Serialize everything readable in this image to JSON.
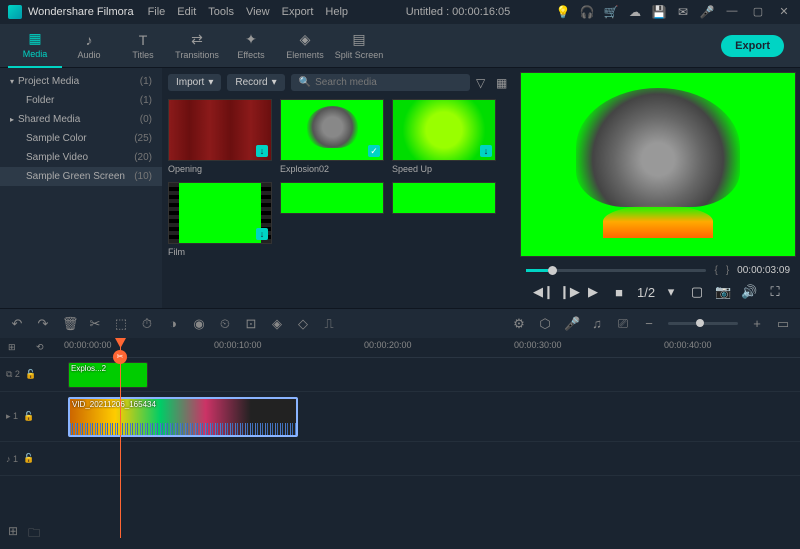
{
  "app": {
    "name": "Wondershare Filmora"
  },
  "menu": [
    "File",
    "Edit",
    "Tools",
    "View",
    "Export",
    "Help"
  ],
  "title_center": "Untitled : 00:00:16:05",
  "tabs": [
    {
      "label": "Media",
      "icon": "▦"
    },
    {
      "label": "Audio",
      "icon": "♪"
    },
    {
      "label": "Titles",
      "icon": "T"
    },
    {
      "label": "Transitions",
      "icon": "⇄"
    },
    {
      "label": "Effects",
      "icon": "✦"
    },
    {
      "label": "Elements",
      "icon": "◈"
    },
    {
      "label": "Split Screen",
      "icon": "▤"
    }
  ],
  "export_label": "Export",
  "sidebar": {
    "items": [
      {
        "label": "Project Media",
        "count": "(1)",
        "tri": "▾",
        "indent": 0
      },
      {
        "label": "Folder",
        "count": "(1)",
        "tri": "",
        "indent": 1
      },
      {
        "label": "Shared Media",
        "count": "(0)",
        "tri": "▸",
        "indent": 0
      },
      {
        "label": "Sample Color",
        "count": "(25)",
        "tri": "",
        "indent": 1
      },
      {
        "label": "Sample Video",
        "count": "(20)",
        "tri": "",
        "indent": 1
      },
      {
        "label": "Sample Green Screen",
        "count": "(10)",
        "tri": "",
        "indent": 1
      }
    ]
  },
  "media_bar": {
    "import": "Import",
    "record": "Record",
    "search_placeholder": "Search media"
  },
  "thumbs": [
    {
      "label": "Opening",
      "kind": "curtain"
    },
    {
      "label": "Explosion02",
      "kind": "smoke",
      "checked": true
    },
    {
      "label": "Speed Up",
      "kind": "green"
    },
    {
      "label": "Film",
      "kind": "film"
    },
    {
      "label": "",
      "kind": "green2"
    },
    {
      "label": "",
      "kind": "green3"
    }
  ],
  "preview": {
    "bracket_l": "{",
    "bracket_r": "}",
    "timecode": "00:00:03:09",
    "speed": "1/2"
  },
  "ruler": {
    "marks": [
      "00:00:00:00",
      "00:00:10:00",
      "00:00:20:00",
      "00:00:30:00",
      "00:00:40:00"
    ]
  },
  "tracks": {
    "fx": "⧉ 2",
    "v1": "▸ 1",
    "a1": "♪ 1",
    "clip_green": "Explos...2",
    "clip_video": "VID_20211206_165434"
  }
}
